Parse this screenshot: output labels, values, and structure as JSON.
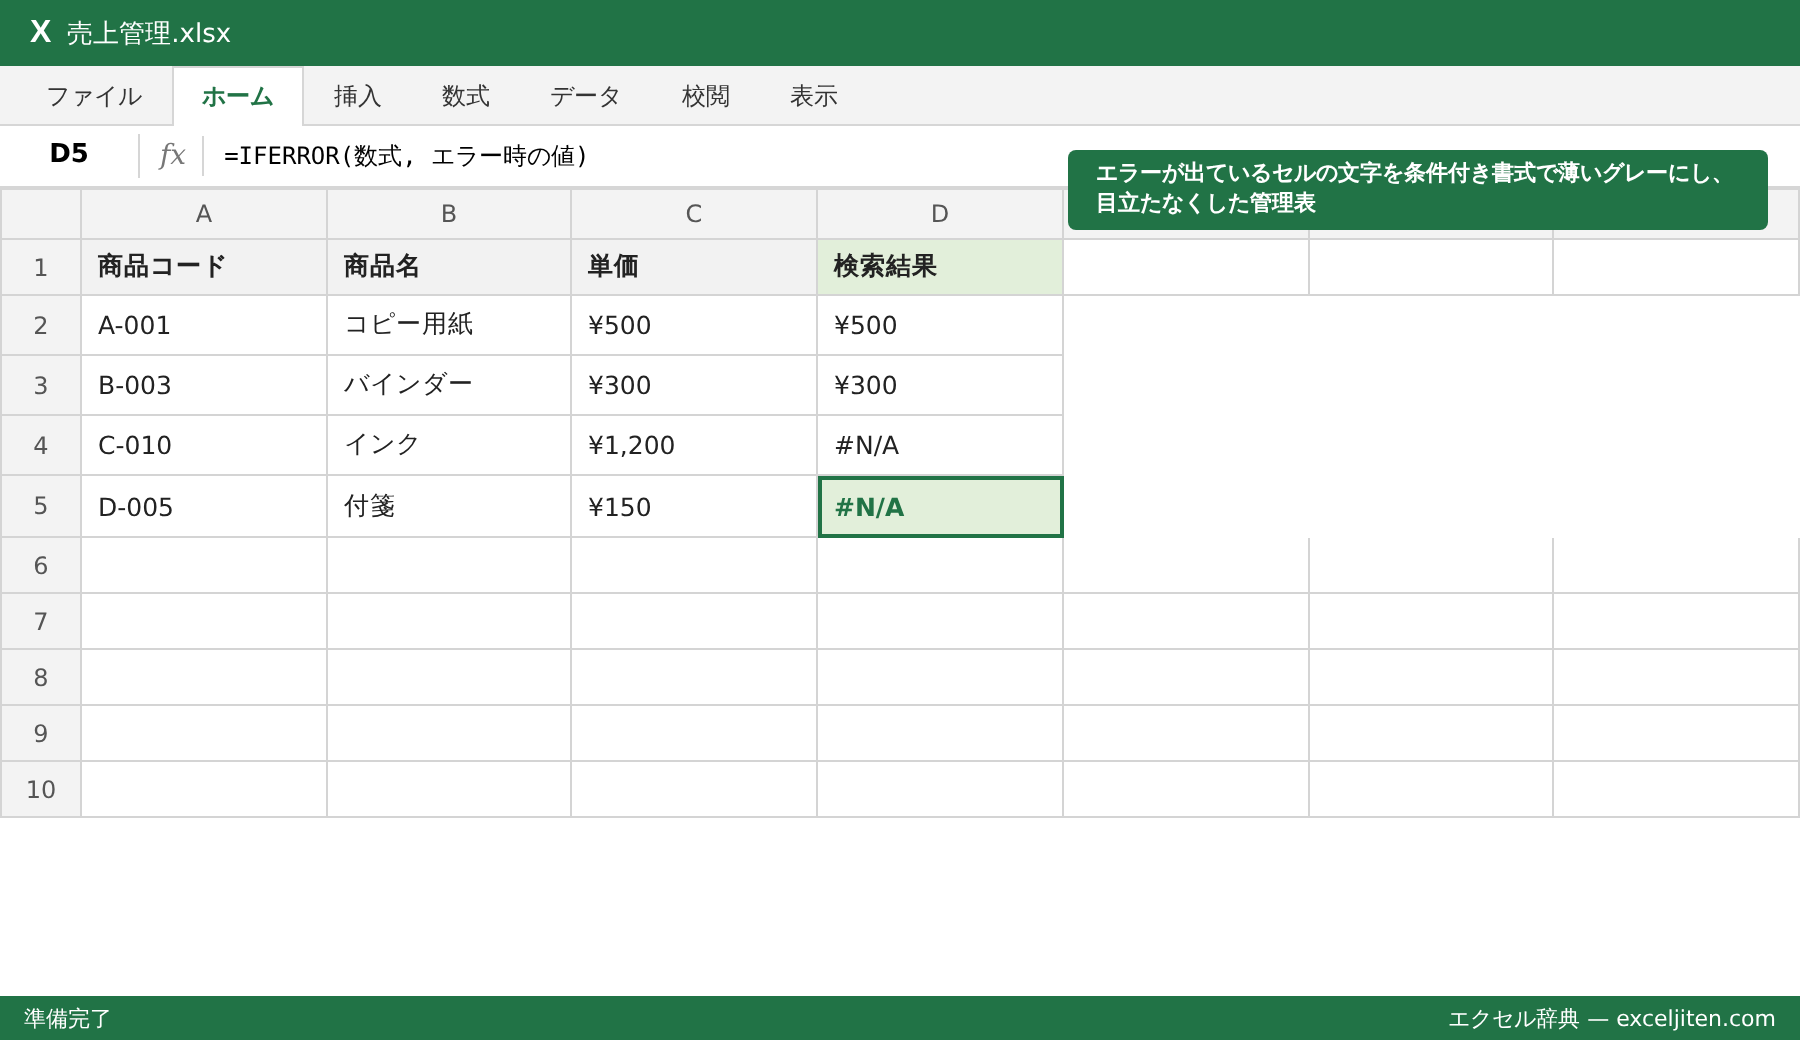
{
  "window": {
    "app_icon": "X",
    "title": "売上管理.xlsx"
  },
  "ribbon_tabs": [
    {
      "label": "ファイル",
      "selected": false
    },
    {
      "label": "ホーム",
      "selected": true
    },
    {
      "label": "挿入",
      "selected": false
    },
    {
      "label": "数式",
      "selected": false
    },
    {
      "label": "データ",
      "selected": false
    },
    {
      "label": "校閲",
      "selected": false
    },
    {
      "label": "表示",
      "selected": false
    }
  ],
  "formula_bar": {
    "cell_ref": "D5",
    "fx": "fx",
    "formula": "=IFERROR(数式, エラー時の値)"
  },
  "callout": {
    "text": "エラーが出ているセルの文字を条件付き書式で薄いグレーにし、目立たなくした管理表"
  },
  "sheet": {
    "columns": [
      "A",
      "B",
      "C",
      "D"
    ],
    "rows": [
      {
        "number": "1",
        "kind": "header",
        "cells": [
          {
            "text": "商品コード",
            "highlighted": false
          },
          {
            "text": "商品名",
            "highlighted": false
          },
          {
            "text": "単価",
            "highlighted": false
          },
          {
            "text": "検索結果",
            "highlighted": true
          }
        ]
      },
      {
        "number": "2",
        "kind": "data",
        "cells": [
          {
            "text": "A-001",
            "selected": false
          },
          {
            "text": "コピー用紙",
            "selected": false
          },
          {
            "text": "¥500",
            "selected": false
          },
          {
            "text": "¥500",
            "selected": false
          }
        ]
      },
      {
        "number": "3",
        "kind": "data",
        "cells": [
          {
            "text": "B-003",
            "selected": false
          },
          {
            "text": "バインダー",
            "selected": false
          },
          {
            "text": "¥300",
            "selected": false
          },
          {
            "text": "¥300",
            "selected": false
          }
        ]
      },
      {
        "number": "4",
        "kind": "data",
        "cells": [
          {
            "text": "C-010",
            "selected": false
          },
          {
            "text": "インク",
            "selected": false
          },
          {
            "text": "¥1,200",
            "selected": false
          },
          {
            "text": "#N/A",
            "selected": false
          }
        ]
      },
      {
        "number": "5",
        "kind": "data",
        "cells": [
          {
            "text": "D-005",
            "selected": false
          },
          {
            "text": "付箋",
            "selected": false
          },
          {
            "text": "¥150",
            "selected": false
          },
          {
            "text": "#N/A",
            "selected": true
          }
        ]
      },
      {
        "number": "6",
        "kind": "empty"
      },
      {
        "number": "7",
        "kind": "empty"
      },
      {
        "number": "8",
        "kind": "empty"
      },
      {
        "number": "9",
        "kind": "empty"
      },
      {
        "number": "10",
        "kind": "empty"
      }
    ]
  },
  "status_bar": {
    "left": "準備完了",
    "right": "エクセル辞典 — exceljiten.com"
  }
}
